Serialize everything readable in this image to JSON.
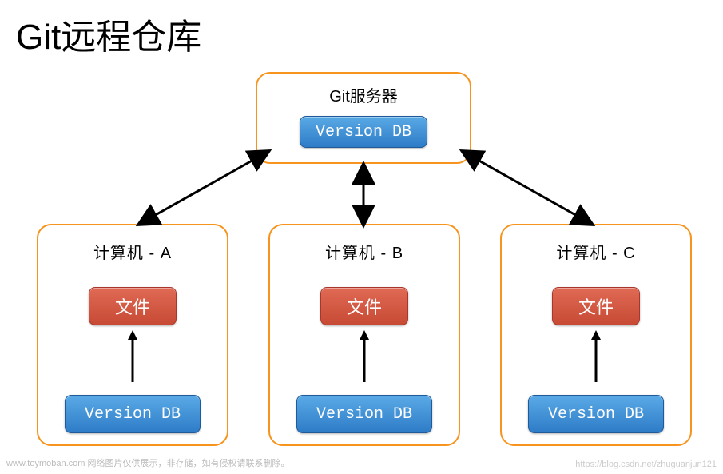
{
  "title": "Git远程仓库",
  "server": {
    "label": "Git服务器",
    "db_label": "Version DB"
  },
  "clients": {
    "a": {
      "label": "计算机 - A",
      "file_label": "文件",
      "db_label": "Version DB"
    },
    "b": {
      "label": "计算机 - B",
      "file_label": "文件",
      "db_label": "Version DB"
    },
    "c": {
      "label": "计算机 - C",
      "file_label": "文件",
      "db_label": "Version DB"
    }
  },
  "watermark": {
    "left": "www.toymoban.com 网络图片仅供展示，非存储，如有侵权请联系删除。",
    "right": "https://blog.csdn.net/zhuguanjun121"
  }
}
